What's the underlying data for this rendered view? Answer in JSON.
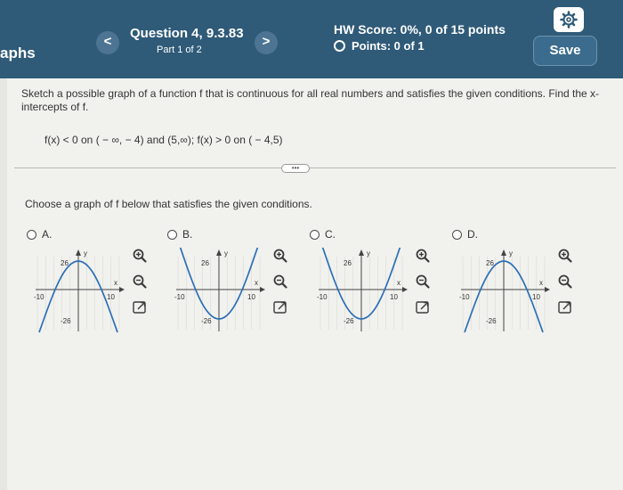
{
  "header": {
    "app_title": "aphs",
    "prev_label": "<",
    "next_label": ">",
    "question_title": "Question 4, 9.3.83",
    "part": "Part 1 of 2",
    "hw_score": "HW Score: 0%, 0 of 15 points",
    "points": "Points: 0 of 1",
    "save_label": "Save"
  },
  "question": {
    "prompt": "Sketch a possible graph of a function f that is continuous for all real numbers and satisfies the given conditions. Find the x-intercepts of f.",
    "conditions": "f(x) < 0 on ( − ∞, − 4) and (5,∞); f(x) > 0 on ( − 4,5)",
    "more_label": "•••",
    "choose_prompt": "Choose a graph of f below that satisfies the given conditions."
  },
  "options": [
    {
      "label": "A.",
      "shape": "cap"
    },
    {
      "label": "B.",
      "shape": "cup"
    },
    {
      "label": "C.",
      "shape": "cup"
    },
    {
      "label": "D.",
      "shape": "cap"
    }
  ],
  "graph_labels": {
    "y_axis": "y",
    "x_axis": "x",
    "y_tick": "26",
    "y_tick_neg": "-26",
    "x_tick_neg": "-10",
    "x_tick": "10"
  },
  "colors": {
    "header_bg": "#2f5a78",
    "curve": "#2b6fb6",
    "content_bg": "#f1f1ee"
  },
  "icons": [
    "settings-gear-icon",
    "zoom-in-icon",
    "zoom-out-icon",
    "expand-icon"
  ]
}
